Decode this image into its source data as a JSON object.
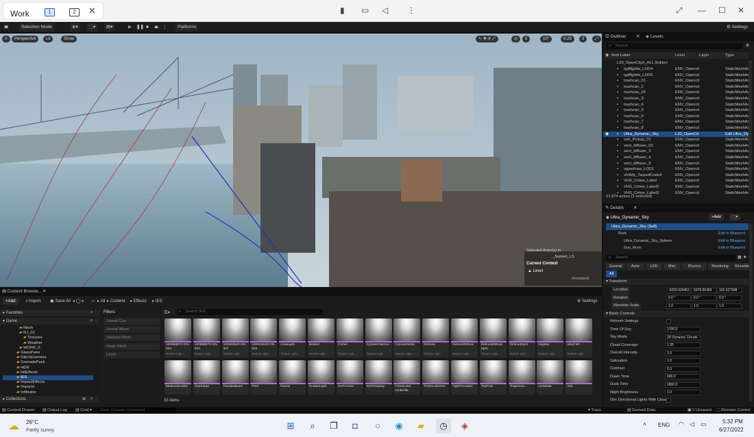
{
  "titlebar": {
    "name": "Work",
    "desktops": [
      "1",
      "2"
    ],
    "icons": [
      "signal-icon",
      "monitor-icon",
      "volume-icon",
      "more-vert-icon",
      "expand-icon",
      "minimize-icon",
      "maximize-icon",
      "close-icon"
    ]
  },
  "toolbar": {
    "mode": "Selection Mode",
    "platforms": "Platforms",
    "settings": "Settings"
  },
  "viewport": {
    "perspective": "Perspective",
    "lit": "Lit",
    "show": "Show",
    "snap_a": "5",
    "snap_b": "10°",
    "snap_c": "0.25",
    "speed": "3",
    "selected_text": "Selected Actor(s) in",
    "level_name": "_Sunset_LS",
    "context_title": "Current Context",
    "level_label": "Level",
    "level_value": "(Persistent)"
  },
  "outliner": {
    "tab": "Outliner",
    "tab2": "Levels",
    "search_placeholder": "Search",
    "col_label": "Item Label",
    "col_level": "Level",
    "col_layer": "Layer",
    "col_type": "Type",
    "root": "L20_OpenCity3_ALL (Editor)",
    "rows": [
      {
        "name": "tgdffgdda_LOD4",
        "level": "ENV_Opencit",
        "type": "StaticMeshAc"
      },
      {
        "name": "tgdffgdda_LOD5",
        "level": "ENV_Opencit",
        "type": "StaticMeshAc"
      },
      {
        "name": "trashcan_01",
        "level": "ENV_Opencit",
        "type": "StaticMeshAc"
      },
      {
        "name": "trashcan_2",
        "level": "ENV_Opencit",
        "type": "StaticMeshAc"
      },
      {
        "name": "trashcan_02",
        "level": "ENV_Opencit",
        "type": "StaticMeshAc"
      },
      {
        "name": "trashcan_3",
        "level": "ENV_Opencit",
        "type": "StaticMeshAc"
      },
      {
        "name": "trashcan_4",
        "level": "ENV_Opencit",
        "type": "StaticMeshAc"
      },
      {
        "name": "trashcan_5",
        "level": "ENV_Opencit",
        "type": "StaticMeshAc"
      },
      {
        "name": "trashcan_6",
        "level": "ENV_Opencit",
        "type": "StaticMeshAc"
      },
      {
        "name": "trashcan_7",
        "level": "ENV_Opencit",
        "type": "StaticMeshAc"
      },
      {
        "name": "trashcan_8",
        "level": "ENV_Opencit",
        "type": "StaticMeshAc"
      },
      {
        "name": "Ultra_Dynamic_Sky",
        "level": "L20_OpenCit",
        "type": "Edit Ultra_Dy"
      },
      {
        "name": "veh_Pickup_01",
        "level": "ENV_Opencit",
        "type": "StaticMeshAc"
      },
      {
        "name": "vent_diffuser_02",
        "level": "ENV_Opencit",
        "type": "StaticMeshAc"
      },
      {
        "name": "vent_diffuser_3",
        "level": "ENV_Opencit",
        "type": "StaticMeshAc"
      },
      {
        "name": "vent_diffuser_4",
        "level": "ENV_Opencit",
        "type": "StaticMeshAc"
      },
      {
        "name": "vent_diffuser_5",
        "level": "ENV_Opencit",
        "type": "StaticMeshAc"
      },
      {
        "name": "vgyedcaw_LOD1",
        "level": "ENV_Opencit",
        "type": "StaticMeshAc"
      },
      {
        "name": "vh3bfy_TarpedCrate4",
        "level": "ENV_Opencit",
        "type": "StaticMeshAc"
      },
      {
        "name": "VHS_Crime_Label",
        "level": "ENV_Opencit",
        "type": "StaticMeshAc"
      },
      {
        "name": "VHS_Crime_Label2",
        "level": "ENV_Opencit",
        "type": "StaticMeshAc"
      },
      {
        "name": "VHS_Crime_Label3",
        "level": "ENV_Opencit",
        "type": "StaticMeshAc"
      }
    ],
    "count": "21,974 actors (1 selected)"
  },
  "details": {
    "tab": "Details",
    "object": "Ultra_Dynamic_Sky",
    "add": "+Add",
    "self": "Ultra_Dynamic_Sky (Self)",
    "components": [
      {
        "name": "Root",
        "action": "Edit in Blueprint"
      },
      {
        "name": "Ultra_Dynamic_Sky_Sphere",
        "action": "Edit in Blueprint"
      },
      {
        "name": "Sun_Root",
        "action": "Edit in Blueprint"
      }
    ],
    "search_placeholder": "Search",
    "categories": [
      "General",
      "Actor",
      "LOD",
      "Misc",
      "Physics",
      "Rendering",
      "Streaming",
      "All"
    ],
    "transform_title": "Transform",
    "location_label": "Location",
    "location": [
      "-8229.929453",
      "6978.95459",
      "102.527588"
    ],
    "rotation_label": "Rotation",
    "rotation": [
      "0.0 °",
      "0.0 °",
      "0.0 °"
    ],
    "scale_label": "Absolute Scale",
    "scale": [
      "1.0",
      "1.0",
      "1.0"
    ],
    "basic_title": "Basic Controls",
    "props": [
      {
        "label": "Refresh Settings",
        "value": ""
      },
      {
        "label": "Time Of Day",
        "value": "1700.0"
      },
      {
        "label": "Sky Mode",
        "value": "2D Dynamic Clouds"
      },
      {
        "label": "Cloud Coverage",
        "value": "1.35"
      },
      {
        "label": "Overall Intensity",
        "value": "1.0"
      },
      {
        "label": "Saturation",
        "value": "1.0"
      },
      {
        "label": "Contrast",
        "value": "0.3"
      },
      {
        "label": "Dawn Time",
        "value": "600.0"
      },
      {
        "label": "Dusk Time",
        "value": "1800.0"
      },
      {
        "label": "Night Brightness",
        "value": "1.0"
      },
      {
        "label": "Dim Directional Lights With Cloud...",
        "value": ""
      }
    ]
  },
  "content_browser": {
    "tab": "Content Browse...",
    "add": "+Add",
    "import": "Import",
    "save_all": "Save All",
    "settings": "Settings",
    "breadcrumb": [
      "All",
      "Content",
      "Effects",
      "IES"
    ],
    "favorites": "Favorites",
    "game": "Game",
    "tree": [
      "Mesh",
      "RJ_02",
      "Textures",
      "Weather",
      "WORK_0",
      "GlassPane",
      "GlitchEnemies",
      "GrenadePack",
      "HDR",
      "HitEffects",
      "IES",
      "ImpactEffects",
      "Impacts",
      "Infiltrator"
    ],
    "collections": "Collections",
    "filters_title": "Filters",
    "filters": [
      "Sound Cue",
      "Sound Wave",
      "Skeletal Mesh",
      "Static Mesh",
      "Level"
    ],
    "search_placeholder": "Search IES",
    "assets_row1": [
      {
        "name": "100888870-ON-003",
        "type": "Texture Ligh..."
      },
      {
        "name": "100888870-ON-003",
        "type": "Texture Ligh..."
      },
      {
        "name": "100263640-ON-007",
        "type": "Texture Ligh..."
      },
      {
        "name": "100263640-ON-004",
        "type": "Texture Ligh..."
      },
      {
        "name": "AreaLight",
        "type": "Texture Ligh..."
      },
      {
        "name": "Bollard",
        "type": "Texture Ligh..."
      },
      {
        "name": "Comet",
        "type": "Texture Ligh..."
      },
      {
        "name": "CylinderNarrow",
        "type": "Texture Ligh..."
      },
      {
        "name": "CylinderWide",
        "type": "Texture Ligh..."
      },
      {
        "name": "Defined",
        "type": "Texture Ligh..."
      },
      {
        "name": "DefinedDiffuse",
        "type": "Texture Ligh..."
      },
      {
        "name": "DefinedDiffuse Spot",
        "type": "Texture Ligh..."
      },
      {
        "name": "DefinedSpot",
        "type": "Texture Ligh..."
      },
      {
        "name": "Display",
        "type": "Texture Ligh..."
      },
      {
        "name": "JellyFish",
        "type": "Texture Ligh..."
      }
    ],
    "assets_row2": [
      {
        "name": "MediumScatter",
        "type": ""
      },
      {
        "name": "Overhead",
        "type": ""
      },
      {
        "name": "ParallelBeam",
        "type": ""
      },
      {
        "name": "Pear",
        "type": ""
      },
      {
        "name": "Round",
        "type": ""
      },
      {
        "name": "ScatterLight",
        "type": ""
      },
      {
        "name": "SciFiArrow",
        "type": ""
      },
      {
        "name": "SciFiDisplay",
        "type": ""
      },
      {
        "name": "ThreeLobe Umbrella",
        "type": ""
      },
      {
        "name": "ThreeLobeVee",
        "type": ""
      },
      {
        "name": "TightFocused",
        "type": ""
      },
      {
        "name": "TopPost",
        "type": ""
      },
      {
        "name": "Trapezoid...",
        "type": ""
      },
      {
        "name": "Umbrella",
        "type": ""
      },
      {
        "name": "Vee",
        "type": ""
      }
    ],
    "count": "33 items"
  },
  "statusbar": {
    "drawer": "Content Drawer",
    "output": "Output Log",
    "cmd": "Cmd",
    "console_placeholder": "Enter Console Command",
    "trace": "Trace",
    "derived": "Derived Data",
    "unsaved": "2 Unsaved",
    "revision": "Revision Control"
  },
  "taskbar": {
    "temp": "26°C",
    "weather": "Partly sunny",
    "lang": "ENG",
    "time": "5:32 PM",
    "date": "6/27/2022"
  }
}
